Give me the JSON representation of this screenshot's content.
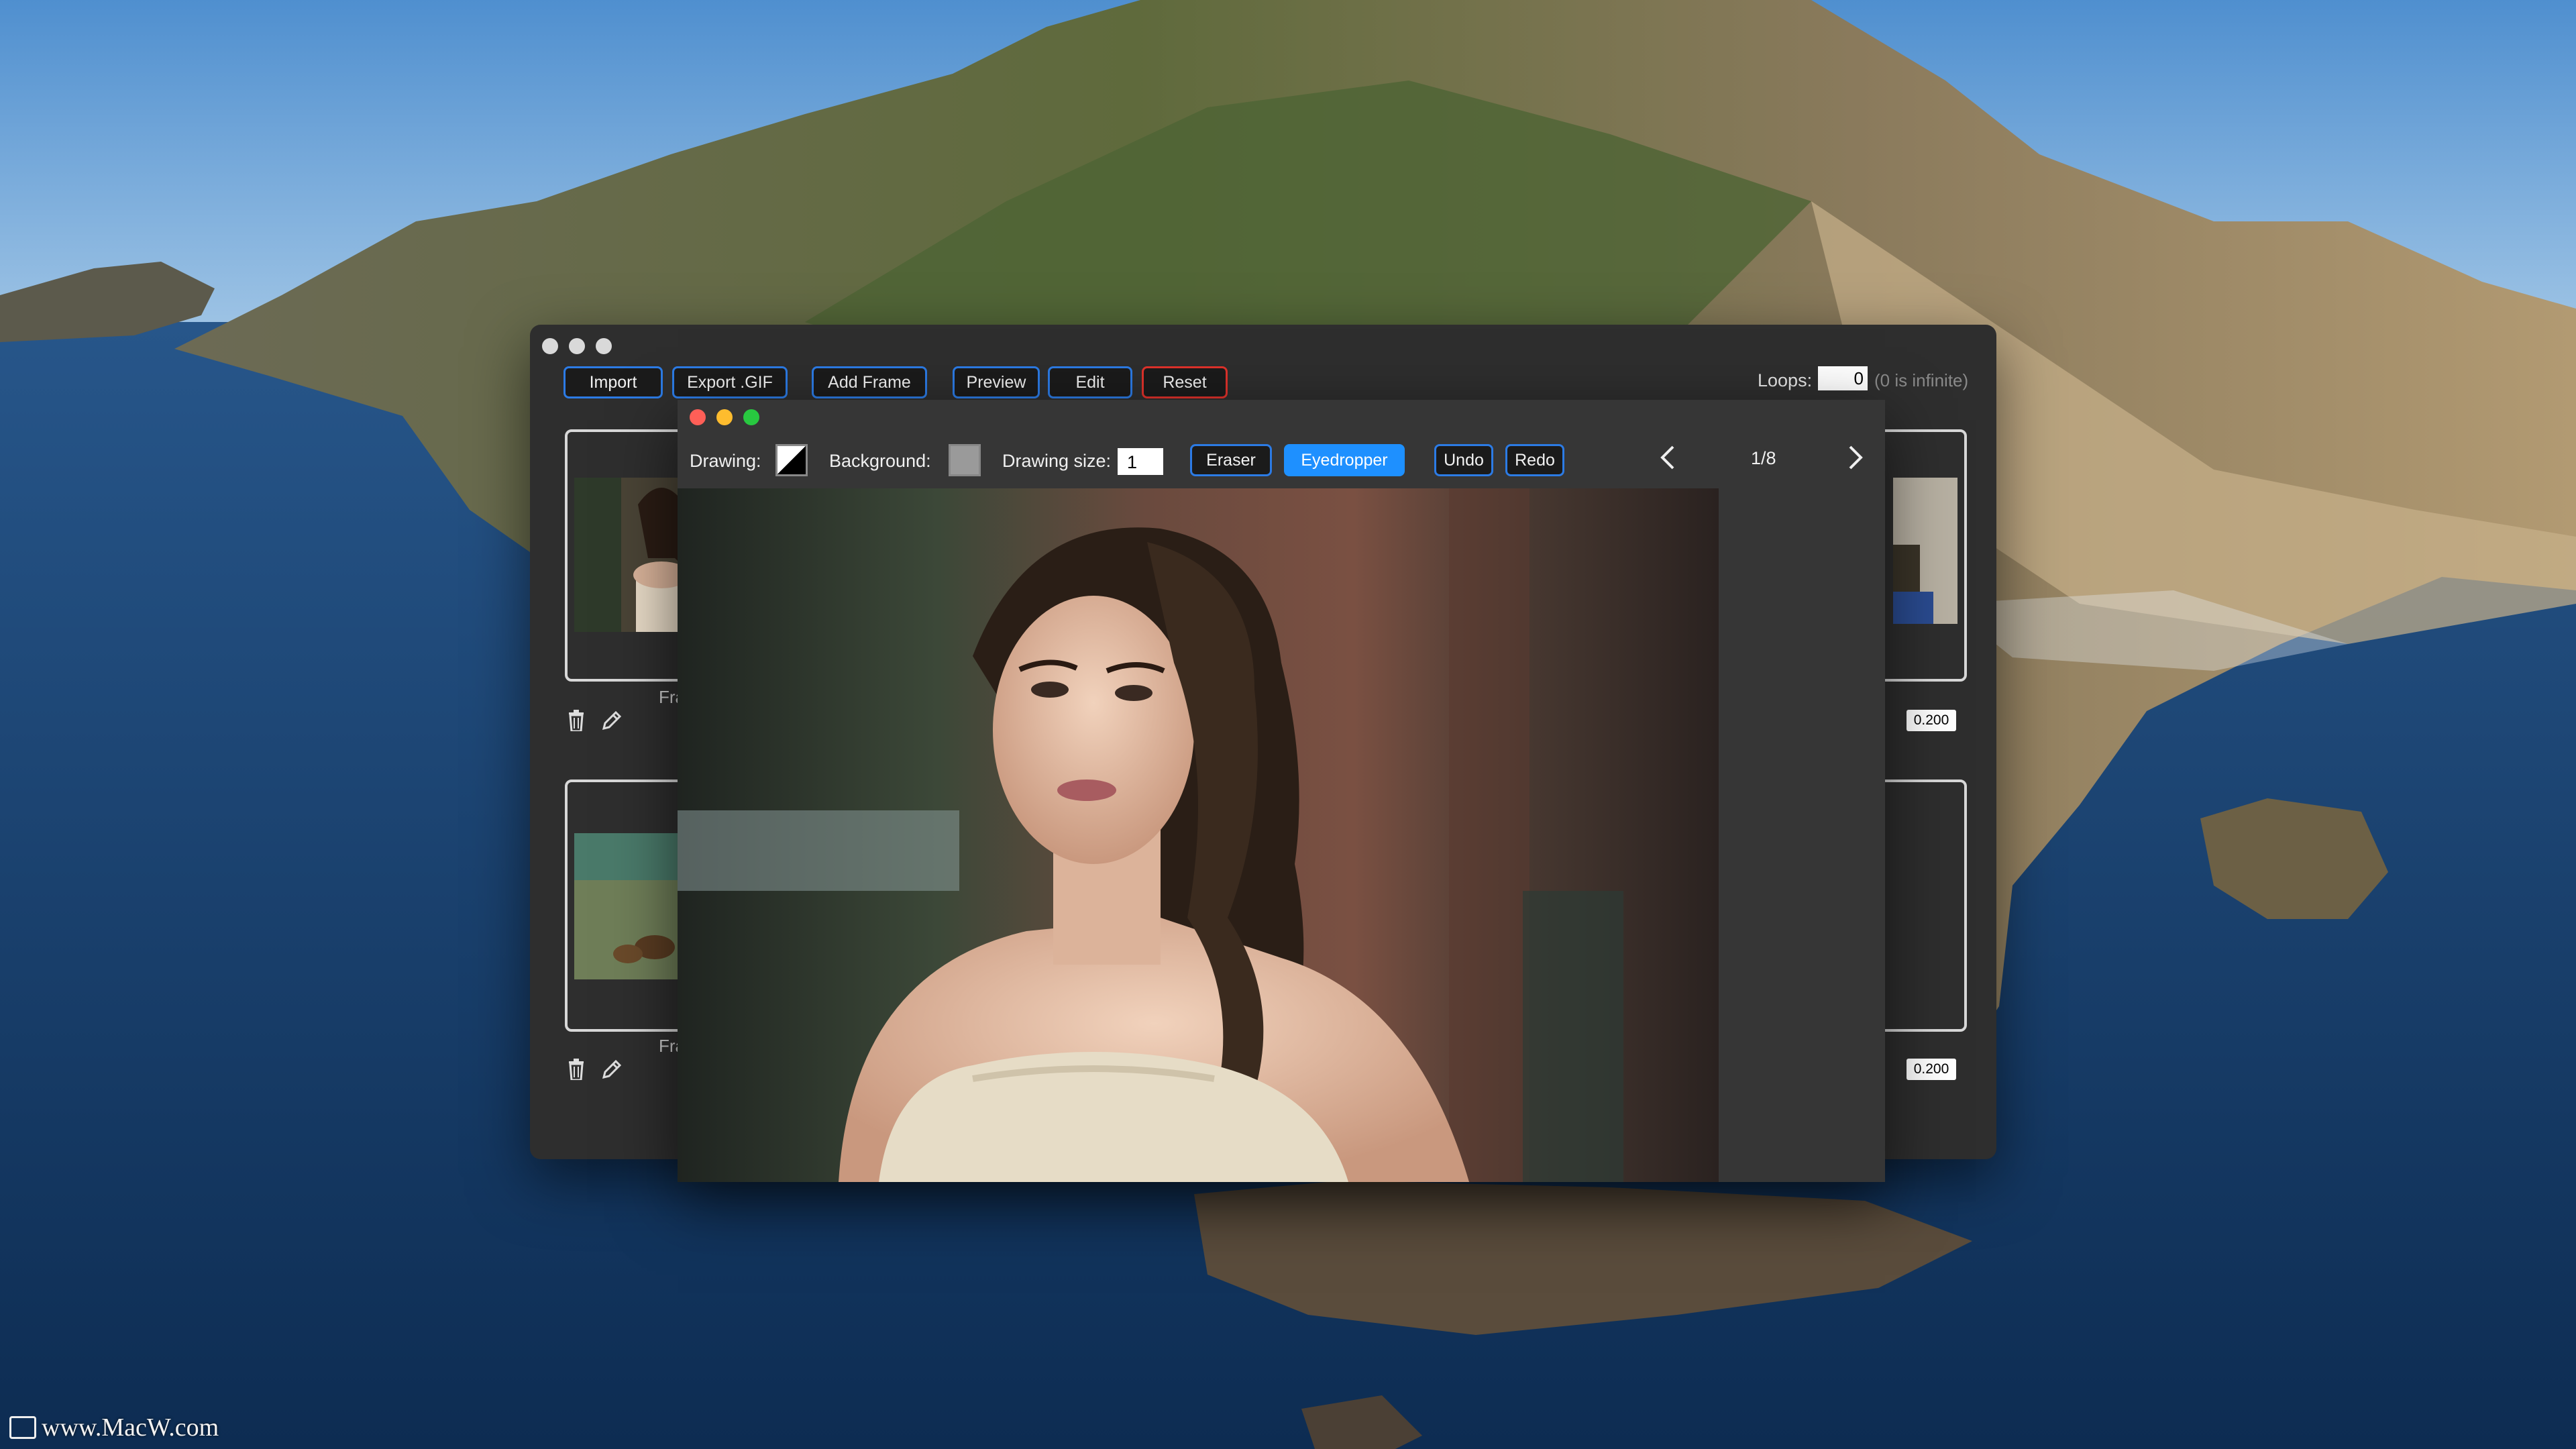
{
  "toolbar": {
    "import_label": "Import",
    "export_label": "Export .GIF",
    "add_frame_label": "Add Frame",
    "preview_label": "Preview",
    "edit_label": "Edit",
    "reset_label": "Reset",
    "loops_label": "Loops:",
    "loops_value": "0",
    "loops_hint": "(0 is infinite)"
  },
  "frames": [
    {
      "label": "Fra",
      "delay": "0.200"
    },
    {
      "label": "Fra",
      "delay": "0.200"
    }
  ],
  "editor": {
    "drawing_label": "Drawing:",
    "background_label": "Background:",
    "drawing_size_label": "Drawing size:",
    "drawing_size_value": "1",
    "eraser_label": "Eraser",
    "eyedropper_label": "Eyedropper",
    "undo_label": "Undo",
    "redo_label": "Redo",
    "page_indicator": "1/8"
  },
  "watermark": "www.MacW.com",
  "colors": {
    "accent_blue": "#2c7be5",
    "active_blue": "#1e90ff",
    "reset_red": "#e0322b",
    "window_bg": "#2e2e2e",
    "editor_bg": "#363636"
  },
  "icons": [
    "trash-icon",
    "pencil-icon",
    "chevron-left-icon",
    "chevron-right-icon"
  ]
}
